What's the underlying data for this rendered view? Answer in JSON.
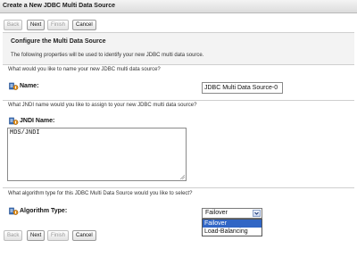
{
  "window": {
    "title": "Create a New JDBC Multi Data Source"
  },
  "toolbar": {
    "back": "Back",
    "next": "Next",
    "finish": "Finish",
    "cancel": "Cancel"
  },
  "section": {
    "title": "Configure the Multi Data Source",
    "description": "The following properties will be used to identify your new JDBC multi data source."
  },
  "name_field": {
    "question": "What would you like to name your new JDBC multi data source?",
    "label": "Name:",
    "value": "JDBC Multi Data Source-0"
  },
  "jndi_field": {
    "question": "What JNDI name would you like to assign to your new JDBC multi data source?",
    "label": "JNDI Name:",
    "value": "MDS/JNDI"
  },
  "algorithm_field": {
    "question": "What algorithm type for this JDBC Multi Data Source would you like to select?",
    "label": "Algorithm Type:",
    "selected": "Failover",
    "options": [
      "Failover",
      "Load-Balancing"
    ]
  },
  "colors": {
    "highlight": "#3166c5",
    "icon_blue": "#3a6fb8",
    "icon_orange": "#e0901e"
  },
  "icons": {
    "field_icon": "property-icon",
    "dropdown_arrow": "chevron-down-icon"
  }
}
